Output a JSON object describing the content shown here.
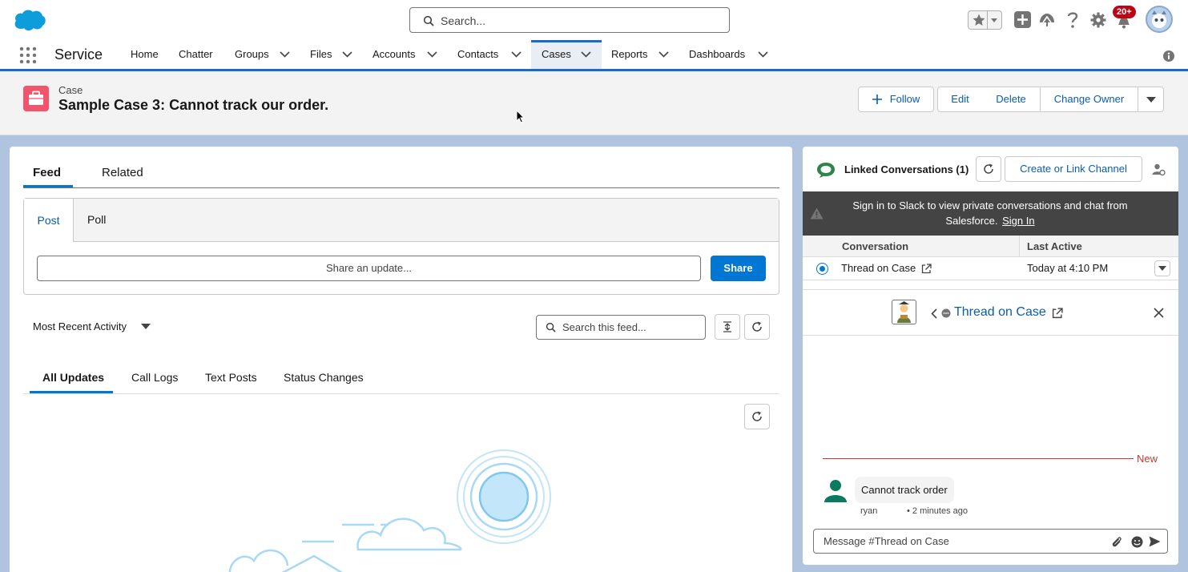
{
  "global_header": {
    "search_placeholder": "Search...",
    "notification_count": "20+"
  },
  "nav": {
    "app_name": "Service",
    "items": [
      {
        "label": "Home"
      },
      {
        "label": "Chatter"
      },
      {
        "label": "Groups"
      },
      {
        "label": "Files"
      },
      {
        "label": "Accounts"
      },
      {
        "label": "Contacts"
      },
      {
        "label": "Cases"
      },
      {
        "label": "Reports"
      },
      {
        "label": "Dashboards"
      }
    ],
    "active": "Cases"
  },
  "record": {
    "type_label": "Case",
    "title": "Sample Case 3: Cannot track our order.",
    "actions": {
      "follow": "Follow",
      "edit": "Edit",
      "delete": "Delete",
      "change_owner": "Change Owner"
    }
  },
  "feed": {
    "tabs": [
      "Feed",
      "Related"
    ],
    "publisher_tabs": [
      "Post",
      "Poll"
    ],
    "share_placeholder": "Share an update...",
    "share_label": "Share",
    "sort_label": "Most Recent Activity",
    "search_placeholder": "Search this feed...",
    "filter_tabs": [
      "All Updates",
      "Call Logs",
      "Text Posts",
      "Status Changes"
    ]
  },
  "slack": {
    "title": "Linked Conversations (1)",
    "create_link_label": "Create or Link Channel",
    "banner_text": "Sign in to Slack to view private conversations and chat from Salesforce.",
    "sign_in_label": "Sign In",
    "columns": [
      "Conversation",
      "Last Active"
    ],
    "rows": [
      {
        "conversation": "Thread on Case",
        "last_active": "Today at 4:10 PM"
      }
    ],
    "thread_title": "Thread on Case",
    "new_label": "New",
    "message": {
      "text": "Cannot track order",
      "author": "ryan",
      "time": "• 2 minutes ago"
    },
    "compose_placeholder": "Message #Thread on Case"
  },
  "colors": {
    "brand": "#0176d3",
    "nav_accent": "#1b6ac9",
    "case_icon": "#f2536d",
    "new_divider": "#c23934",
    "slack_green": "#2e844a"
  }
}
